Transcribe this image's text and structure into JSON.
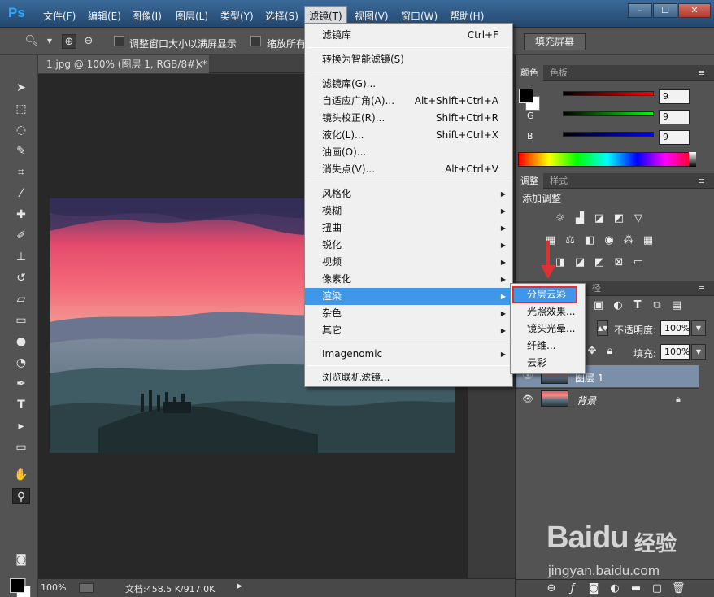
{
  "app": {
    "logo": "Ps",
    "menus": [
      "文件(F)",
      "编辑(E)",
      "图像(I)",
      "图层(L)",
      "类型(Y)",
      "选择(S)",
      "滤镜(T)",
      "视图(V)",
      "窗口(W)",
      "帮助(H)"
    ],
    "active_menu_index": 6,
    "window_controls": [
      "–",
      "☐",
      "✕"
    ]
  },
  "options_bar": {
    "resize_windows_label": "调整窗口大小以满屏显示",
    "zoom_all_label": "缩放所有",
    "fill_screen_label": "填充屏幕"
  },
  "document": {
    "tab_title": "1.jpg @ 100% (图层 1, RGB/8#) *",
    "close_glyph": "×",
    "zoom": "100%",
    "doc_info": "文档:458.5 K/917.0K"
  },
  "filter_menu": {
    "items": [
      {
        "label": "滤镜库",
        "shortcut": "Ctrl+F"
      },
      {
        "label": "转换为智能滤镜(S)"
      },
      {
        "label": "滤镜库(G)..."
      },
      {
        "label": "自适应广角(A)...",
        "shortcut": "Alt+Shift+Ctrl+A"
      },
      {
        "label": "镜头校正(R)...",
        "shortcut": "Shift+Ctrl+R"
      },
      {
        "label": "液化(L)...",
        "shortcut": "Shift+Ctrl+X"
      },
      {
        "label": "油画(O)..."
      },
      {
        "label": "消失点(V)...",
        "shortcut": "Alt+Ctrl+V"
      },
      {
        "label": "风格化",
        "submenu": true
      },
      {
        "label": "模糊",
        "submenu": true
      },
      {
        "label": "扭曲",
        "submenu": true
      },
      {
        "label": "锐化",
        "submenu": true
      },
      {
        "label": "视频",
        "submenu": true
      },
      {
        "label": "像素化",
        "submenu": true
      },
      {
        "label": "渲染",
        "submenu": true,
        "highlighted": true
      },
      {
        "label": "杂色",
        "submenu": true
      },
      {
        "label": "其它",
        "submenu": true
      },
      {
        "label": "Imagenomic",
        "submenu": true
      },
      {
        "label": "浏览联机滤镜..."
      }
    ]
  },
  "render_submenu": {
    "items": [
      {
        "label": "分层云彩",
        "highlighted": true
      },
      {
        "label": "光照效果..."
      },
      {
        "label": "镜头光晕..."
      },
      {
        "label": "纤维..."
      },
      {
        "label": "云彩"
      }
    ]
  },
  "color_panel": {
    "tabs": [
      "颜色",
      "色板"
    ],
    "channels": [
      {
        "label": "R",
        "value": "9",
        "gradient": "#ff0000"
      },
      {
        "label": "G",
        "value": "9",
        "gradient": "#00ff00"
      },
      {
        "label": "B",
        "value": "9",
        "gradient": "#0000ff"
      }
    ]
  },
  "adjustments_panel": {
    "tabs": [
      "调整",
      "样式"
    ],
    "title": "添加调整"
  },
  "layers_panel": {
    "tab_suffix": "径",
    "opacity_label": "不透明度:",
    "opacity_value": "100%",
    "fill_label": "填充:",
    "fill_value": "100%",
    "layers": [
      {
        "name": "图层 1",
        "selected": true
      },
      {
        "name": "背景",
        "locked": true
      }
    ]
  },
  "watermark": {
    "brand": "Baidu",
    "brand_cn": "经验",
    "url": "jingyan.baidu.com"
  },
  "colors": {
    "menu_highlight": "#3e97e8",
    "annotation_red": "#e23030",
    "sky_pink": "#f05a74",
    "sky_purple": "#4e3c6e"
  }
}
